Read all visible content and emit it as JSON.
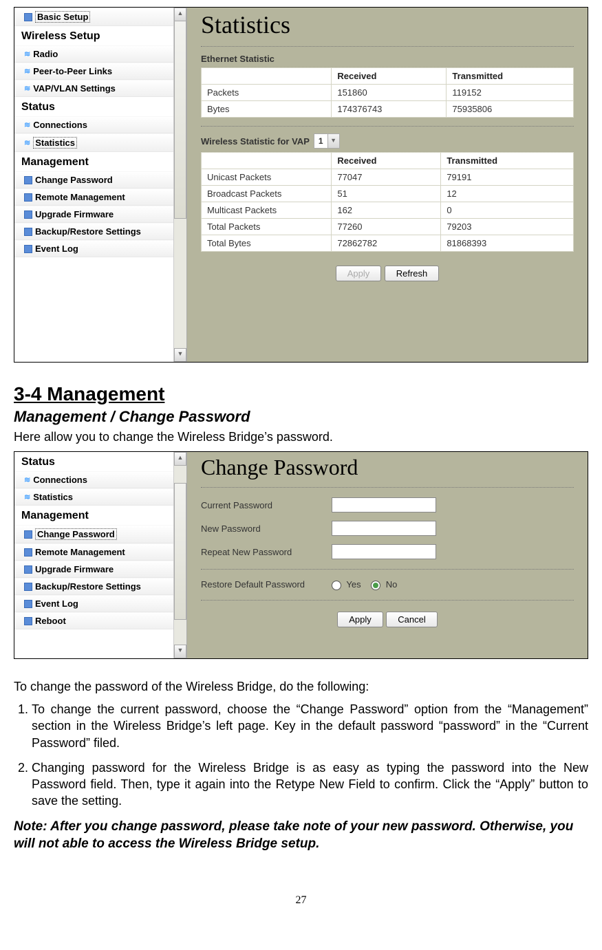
{
  "screenshot1": {
    "sidebar": {
      "items": [
        {
          "kind": "item",
          "icon": "sq",
          "label": "Basic Setup",
          "selected": true
        },
        {
          "kind": "heading",
          "label": "Wireless Setup"
        },
        {
          "kind": "item",
          "icon": "rss",
          "label": "Radio"
        },
        {
          "kind": "item",
          "icon": "rss",
          "label": "Peer-to-Peer Links"
        },
        {
          "kind": "item",
          "icon": "rss",
          "label": "VAP/VLAN Settings"
        },
        {
          "kind": "heading",
          "label": "Status"
        },
        {
          "kind": "item",
          "icon": "rss",
          "label": "Connections"
        },
        {
          "kind": "item",
          "icon": "rss",
          "label": "Statistics",
          "selected": true
        },
        {
          "kind": "heading",
          "label": "Management"
        },
        {
          "kind": "item",
          "icon": "sq",
          "label": "Change Password"
        },
        {
          "kind": "item",
          "icon": "sq",
          "label": "Remote Management"
        },
        {
          "kind": "item",
          "icon": "sq",
          "label": "Upgrade Firmware"
        },
        {
          "kind": "item",
          "icon": "sq",
          "label": "Backup/Restore Settings"
        },
        {
          "kind": "item",
          "icon": "sq",
          "label": "Event Log"
        }
      ]
    },
    "title": "Statistics",
    "eth_label": "Ethernet Statistic",
    "col_received": "Received",
    "col_transmitted": "Transmitted",
    "eth_rows": [
      {
        "label": "Packets",
        "rx": "151860",
        "tx": "119152"
      },
      {
        "label": "Bytes",
        "rx": "174376743",
        "tx": "75935806"
      }
    ],
    "wlan_label": "Wireless Statistic for VAP",
    "vap_selected": "1",
    "wlan_rows": [
      {
        "label": "Unicast Packets",
        "rx": "77047",
        "tx": "79191"
      },
      {
        "label": "Broadcast Packets",
        "rx": "51",
        "tx": "12"
      },
      {
        "label": "Multicast Packets",
        "rx": "162",
        "tx": "0"
      },
      {
        "label": "Total Packets",
        "rx": "77260",
        "tx": "79203"
      },
      {
        "label": "Total Bytes",
        "rx": "72862782",
        "tx": "81868393"
      }
    ],
    "apply_label": "Apply",
    "refresh_label": "Refresh"
  },
  "doc": {
    "h2": "3-4 Management",
    "h3": "Management / Change Password",
    "p1": "Here allow you to change the Wireless Bridge’s password.",
    "p2": "To change the password of the Wireless Bridge, do the following:",
    "li1": "To change the current password, choose the “Change Password” option from the “Management” section in the Wireless Bridge’s left page. Key in the default password “password” in the “Current Password” filed.",
    "li2": "Changing password for the Wireless Bridge is as easy as typing the password into the New Password field. Then, type it again into the Retype New Field to confirm. Click the “Apply” button to save the setting.",
    "note": "Note: After you change password, please take note of your new password. Otherwise, you will not able to access the Wireless Bridge setup.",
    "page_number": "27"
  },
  "screenshot2": {
    "sidebar": {
      "items": [
        {
          "kind": "heading",
          "label": "Status"
        },
        {
          "kind": "item",
          "icon": "rss",
          "label": "Connections"
        },
        {
          "kind": "item",
          "icon": "rss",
          "label": "Statistics"
        },
        {
          "kind": "heading",
          "label": "Management"
        },
        {
          "kind": "item",
          "icon": "sq",
          "label": "Change Password",
          "selected": true
        },
        {
          "kind": "item",
          "icon": "sq",
          "label": "Remote Management"
        },
        {
          "kind": "item",
          "icon": "sq",
          "label": "Upgrade Firmware"
        },
        {
          "kind": "item",
          "icon": "sq",
          "label": "Backup/Restore Settings"
        },
        {
          "kind": "item",
          "icon": "sq",
          "label": "Event Log"
        },
        {
          "kind": "item",
          "icon": "sq",
          "label": "Reboot"
        }
      ]
    },
    "title": "Change Password",
    "fields": {
      "current": "Current Password",
      "newp": "New Password",
      "repeat": "Repeat New Password",
      "restore": "Restore Default Password",
      "yes": "Yes",
      "no": "No"
    },
    "apply_label": "Apply",
    "cancel_label": "Cancel"
  }
}
